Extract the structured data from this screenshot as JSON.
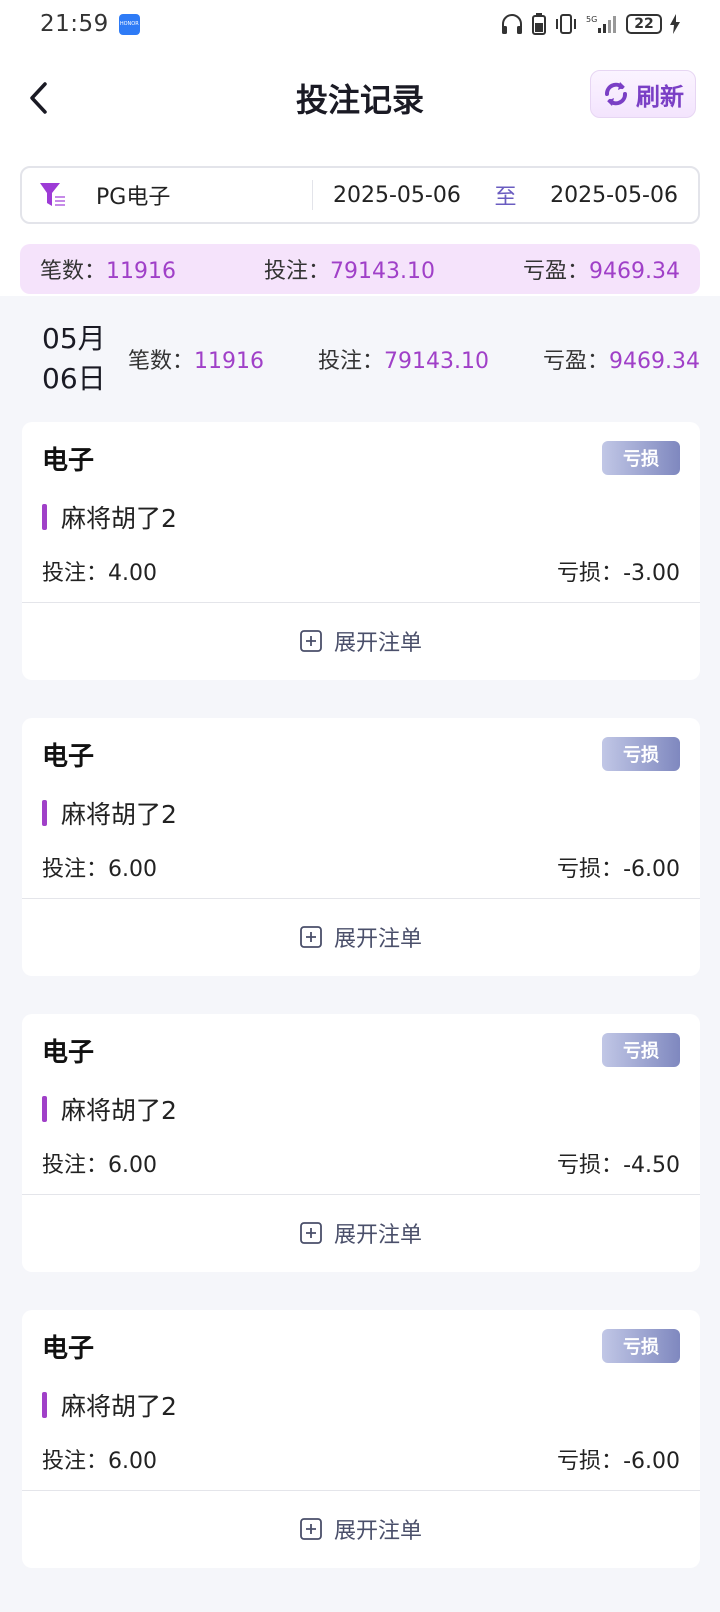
{
  "status_bar": {
    "time": "21:59",
    "battery": "22"
  },
  "nav": {
    "title": "投注记录",
    "refresh_label": "刷新"
  },
  "filter": {
    "category": "PG电子",
    "date_from": "2025-05-06",
    "separator": "至",
    "date_to": "2025-05-06"
  },
  "summary": {
    "count_label": "笔数：",
    "count_value": "11916",
    "bet_label": "投注：",
    "bet_value": "79143.10",
    "pl_label": "亏盈：",
    "pl_value": "9469.34"
  },
  "day_group": {
    "month": "05月",
    "day": "06日",
    "count_label": "笔数：",
    "count_value": "11916",
    "bet_label": "投注：",
    "bet_value": "79143.10",
    "pl_label": "亏盈：",
    "pl_value": "9469.34"
  },
  "records": [
    {
      "type": "电子",
      "badge": "亏损",
      "game": "麻将胡了2",
      "bet_label": "投注：",
      "bet": "4.00",
      "result_label": "亏损：",
      "result": "-3.00",
      "expand_label": "展开注单"
    },
    {
      "type": "电子",
      "badge": "亏损",
      "game": "麻将胡了2",
      "bet_label": "投注：",
      "bet": "6.00",
      "result_label": "亏损：",
      "result": "-6.00",
      "expand_label": "展开注单"
    },
    {
      "type": "电子",
      "badge": "亏损",
      "game": "麻将胡了2",
      "bet_label": "投注：",
      "bet": "6.00",
      "result_label": "亏损：",
      "result": "-4.50",
      "expand_label": "展开注单"
    },
    {
      "type": "电子",
      "badge": "亏损",
      "game": "麻将胡了2",
      "bet_label": "投注：",
      "bet": "6.00",
      "result_label": "亏损：",
      "result": "-6.00",
      "expand_label": "展开注单"
    }
  ],
  "colors": {
    "accent": "#a040c8",
    "summary_bg": "#f5e3fb",
    "badge": "#7f88bf"
  }
}
